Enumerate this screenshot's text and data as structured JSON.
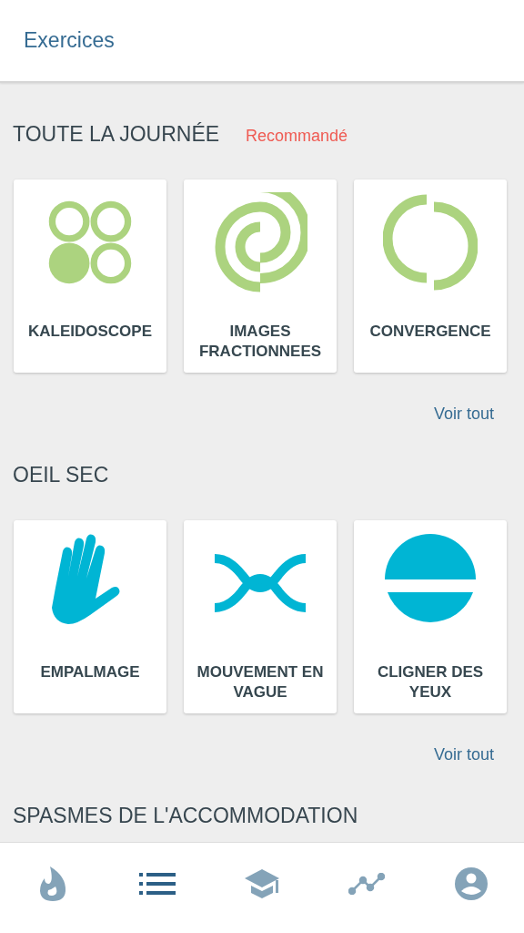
{
  "header": {
    "title": "Exercices"
  },
  "sections": [
    {
      "title": "TOUTE LA JOURNÉE",
      "badge": "Recommandé",
      "link": "Voir tout",
      "exercises": [
        {
          "label": "KALEIDOSCOPE",
          "kind": "circles"
        },
        {
          "label": "IMAGES FRACTIONNEES",
          "kind": "spiral"
        },
        {
          "label": "CONVERGENCE",
          "kind": "split-ring"
        }
      ]
    },
    {
      "title": "OEIL SEC",
      "link": "Voir tout",
      "exercises": [
        {
          "label": "EMPALMAGE",
          "kind": "hand"
        },
        {
          "label": "MOUVEMENT EN VAGUE",
          "kind": "wave"
        },
        {
          "label": "CLIGNER DES YEUX",
          "kind": "blink"
        }
      ]
    },
    {
      "title": "SPASMES DE L'ACCOMMODATION"
    }
  ],
  "nav": [
    {
      "kind": "flame",
      "selected": false
    },
    {
      "kind": "list",
      "selected": true
    },
    {
      "kind": "cap",
      "selected": false
    },
    {
      "kind": "chart",
      "selected": false
    },
    {
      "kind": "profile",
      "selected": false
    }
  ]
}
